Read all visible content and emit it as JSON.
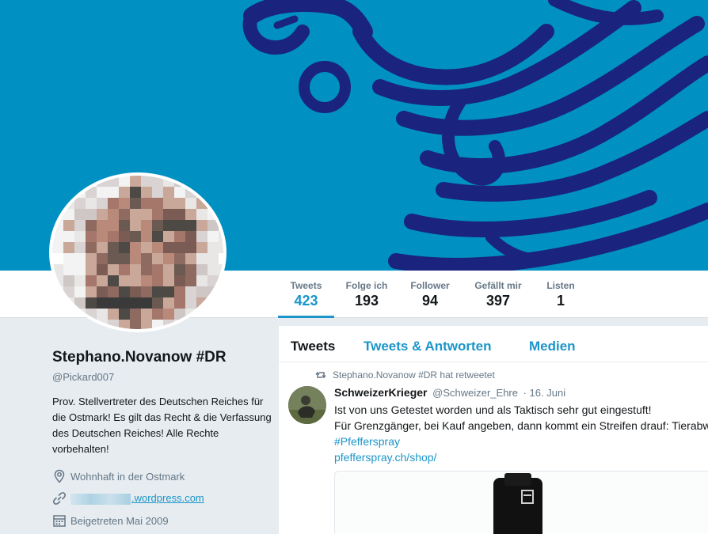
{
  "colors": {
    "banner": "#0091c2",
    "eagle": "#1a237e",
    "accent": "#1b95c9",
    "text": "#14171a",
    "muted": "#657786",
    "page_bg": "#e6ecf0"
  },
  "nav": {
    "stats": [
      {
        "label": "Tweets",
        "value": "423",
        "active": true
      },
      {
        "label": "Folge ich",
        "value": "193"
      },
      {
        "label": "Follower",
        "value": "94"
      },
      {
        "label": "Gefällt mir",
        "value": "397"
      },
      {
        "label": "Listen",
        "value": "1"
      }
    ]
  },
  "profile": {
    "name": "Stephano.Novanow #DR",
    "handle": "@Pickard007",
    "bio": "Prov. Stellvertreter des Deutschen Reiches für die Ostmark! Es gilt das Recht & die Verfassung des Deutschen Reiches! Alle Rechte vorbehalten!",
    "location": "Wohnhaft in der Ostmark",
    "website": ".wordpress.com",
    "joined": "Beigetreten Mai 2009",
    "icons": {
      "location": "location-pin-icon",
      "website": "link-icon",
      "joined": "calendar-icon"
    }
  },
  "timeline": {
    "tabs": [
      "Tweets",
      "Tweets & Antworten",
      "Medien"
    ],
    "tweet": {
      "retweet_label": "Stephano.Novanow #DR hat retweetet",
      "author_name": "SchweizerKrieger",
      "author_handle": "@Schweizer_Ehre",
      "date": "· 16. Juni",
      "line1": "Ist von uns Getestet worden und als Taktisch sehr gut eingestuft!",
      "line2": "Für Grenzgänger, bei Kauf angeben, dann kommt ein Streifen drauf: Tierabwe",
      "hashtag": "#Pfefferspray",
      "link": "pfefferspray.ch/shop/"
    }
  }
}
